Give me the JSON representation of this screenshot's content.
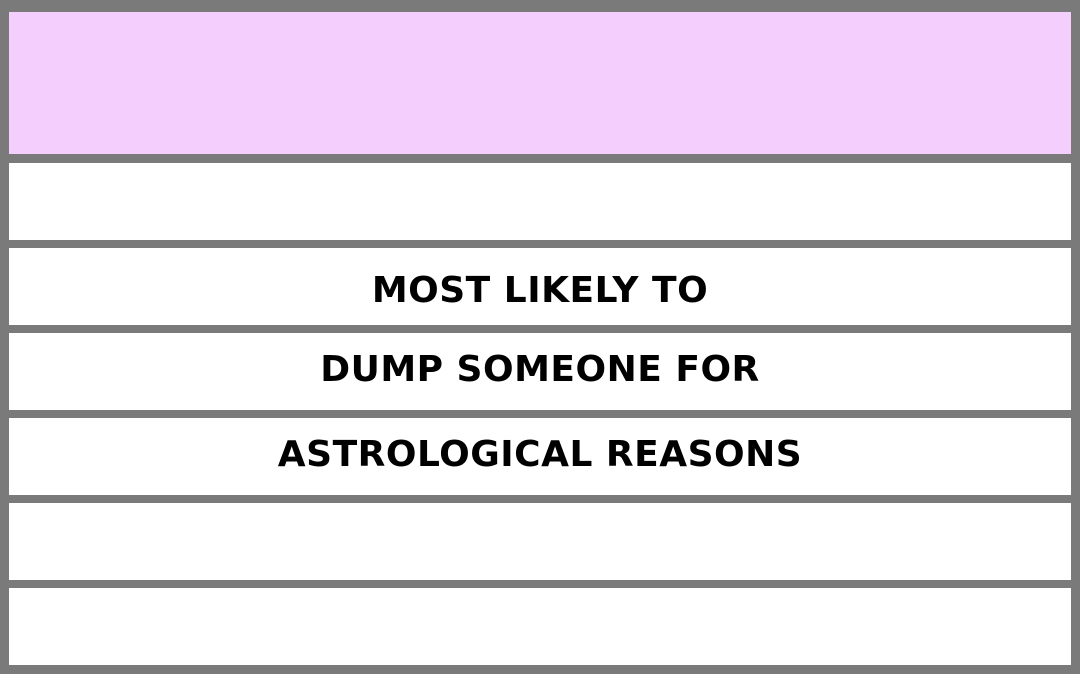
{
  "rows": [
    {
      "text": ""
    },
    {
      "text": ""
    },
    {
      "text": "MOST LIKELY TO"
    },
    {
      "text": "DUMP SOMEONE FOR"
    },
    {
      "text": "ASTROLOGICAL REASONS"
    },
    {
      "text": ""
    },
    {
      "text": ""
    }
  ],
  "colors": {
    "header_fill": "#f4cffd",
    "row_fill": "#ffffff",
    "border": "#7a7a7a",
    "text": "#000000"
  }
}
